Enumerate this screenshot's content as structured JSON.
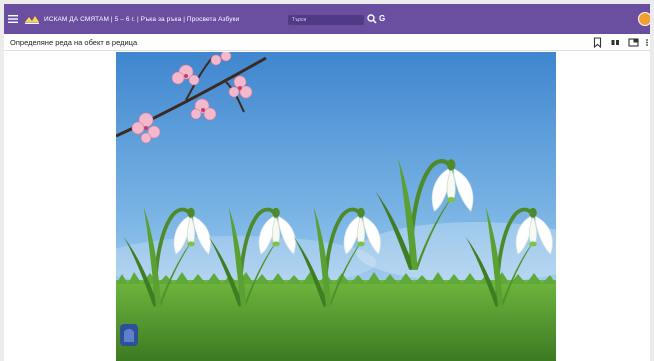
{
  "app": {
    "title": "ИСКАМ ДА СМЯТАМ | 5 – 6 г. | Ръка за ръка | Просвета Азбуки",
    "search_placeholder": "Търси",
    "g_label": "G"
  },
  "subheader": {
    "title": "Определяне реда на обект в редица"
  },
  "icons": {
    "menu": "hamburger-icon",
    "search": "search-icon",
    "bookmark": "bookmark-icon",
    "view": "two-page-icon",
    "fullscreen": "fullscreen-icon"
  },
  "colors": {
    "topbar": "#6a4fa0",
    "sky": "#4a8fd4",
    "grass": "#4f9a2e"
  }
}
